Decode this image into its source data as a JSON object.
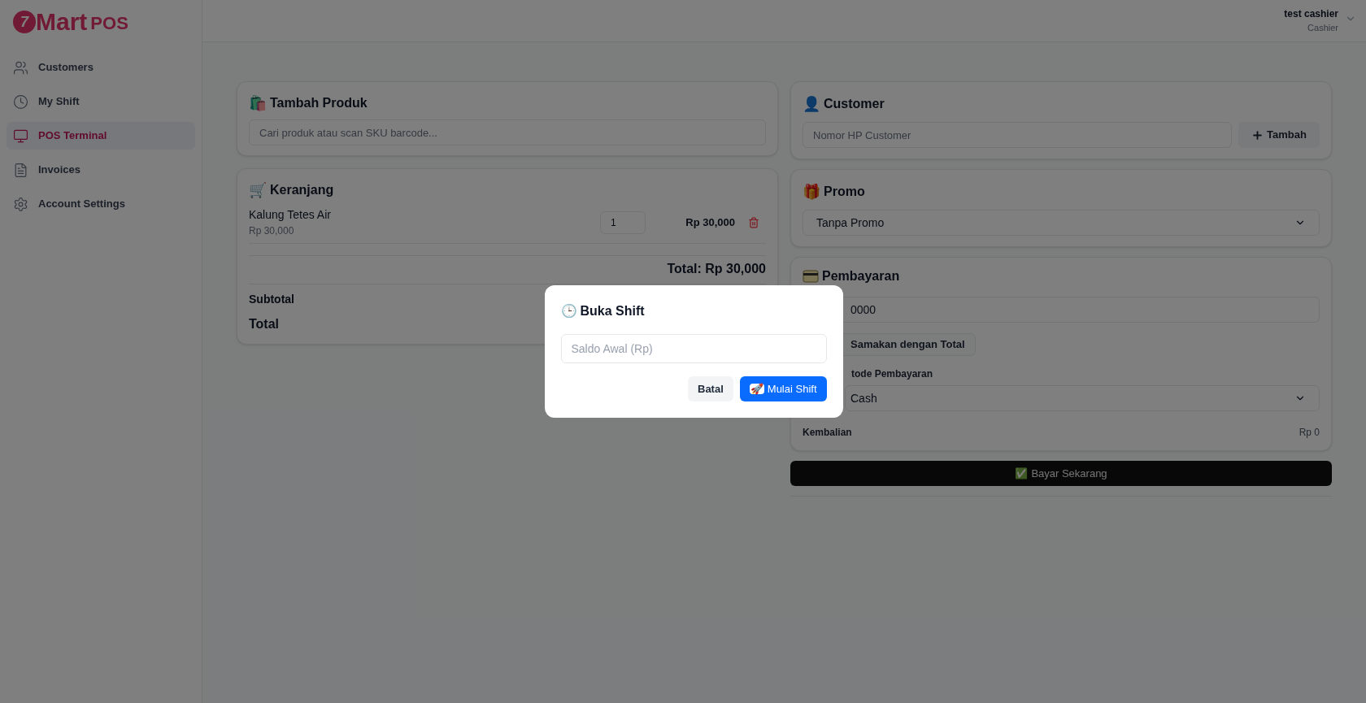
{
  "logo": {
    "mark": "7",
    "word": "Mart",
    "suffix": "POS"
  },
  "sidebar": {
    "items": [
      {
        "label": "Customers",
        "selected": false
      },
      {
        "label": "My Shift",
        "selected": false
      },
      {
        "label": "POS Terminal",
        "selected": true
      },
      {
        "label": "Invoices",
        "selected": false
      },
      {
        "label": "Account Settings",
        "selected": false
      }
    ]
  },
  "user": {
    "name": "test cashier",
    "role": "Cashier"
  },
  "add_product": {
    "emoji": "🛍️",
    "title": "Tambah Produk",
    "search_placeholder": "Cari produk atau scan SKU barcode..."
  },
  "cart": {
    "emoji": "🛒",
    "title": "Keranjang",
    "items": [
      {
        "name": "Kalung Tetes Air",
        "unit_price": "Rp 30,000",
        "qty": "1",
        "line_total": "Rp 30,000"
      }
    ],
    "total": "Total: Rp 30,000",
    "summary": [
      "Subtotal",
      "Total"
    ]
  },
  "customer": {
    "emoji": "👤",
    "title": "Customer",
    "phone_placeholder": "Nomor HP Customer",
    "add_button": "Tambah"
  },
  "promo": {
    "emoji": "🎁",
    "title": "Promo",
    "value": "Tanpa Promo"
  },
  "payment": {
    "title": "Pembayaran",
    "amount": "0000",
    "match_button": "Samakan dengan Total",
    "method_label": "tode Pembayaran",
    "method": "Cash",
    "change_label": "Kembalian",
    "change": "Rp 0",
    "pay_emoji": "✅",
    "pay_button": "Bayar Sekarang"
  },
  "modal": {
    "emoji": "🕒",
    "title": "Buka Shift",
    "placeholder": "Saldo Awal (Rp)",
    "cancel": "Batal",
    "confirm_emoji": "🚀",
    "confirm": "Mulai Shift"
  }
}
